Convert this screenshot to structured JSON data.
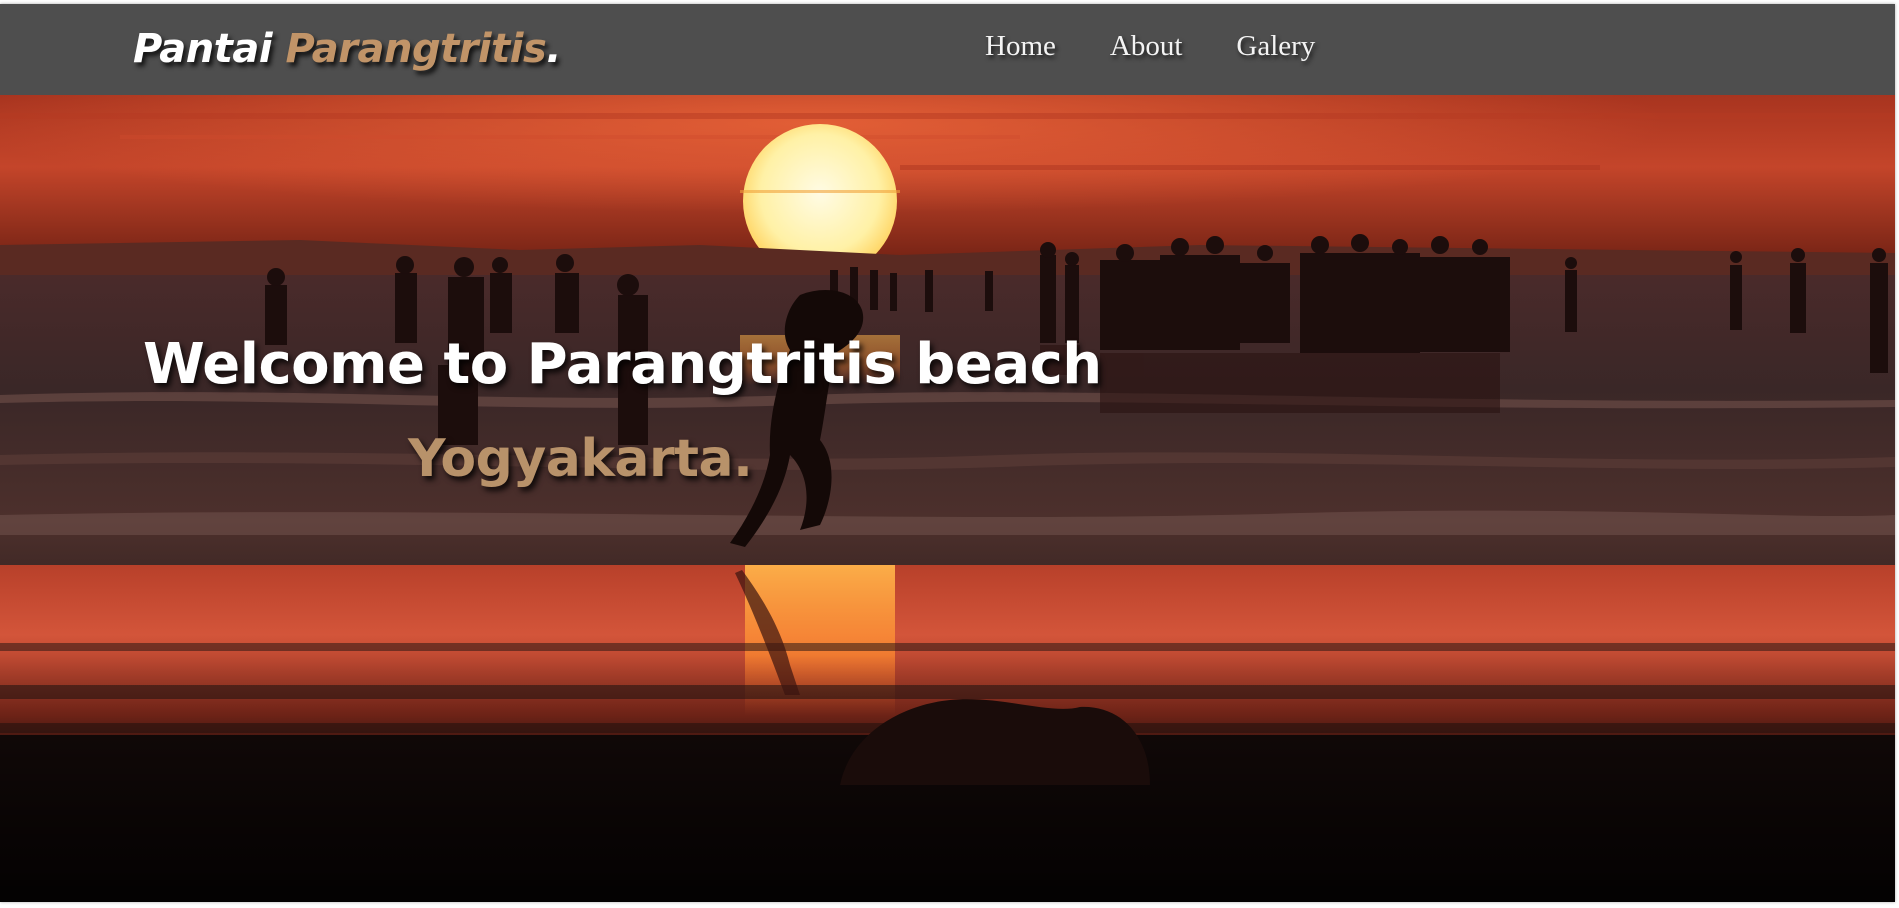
{
  "brand": {
    "name_part1": "Pantai",
    "name_part2": "Parangtritis",
    "name_suffix": ".",
    "accent_color": "#c19468"
  },
  "nav": {
    "items": [
      {
        "label": "Home"
      },
      {
        "label": "About"
      },
      {
        "label": "Galery"
      }
    ],
    "background_color": "#4e4e4e"
  },
  "hero": {
    "title": "Welcome to Parangtritis beach",
    "subtitle": "Yogyakarta.",
    "subtitle_color": "#b8926a",
    "image": "sunset-beach-silhouette-photo"
  }
}
